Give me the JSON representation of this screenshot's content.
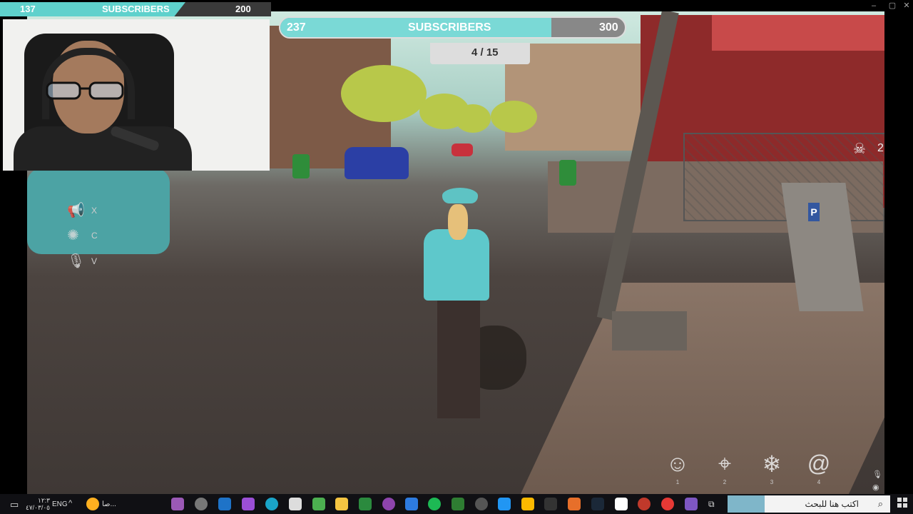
{
  "overlay": {
    "bar_small": {
      "current": "137",
      "label": "SUBSCRIBERS",
      "goal": "200"
    },
    "bar_large": {
      "current": "237",
      "label": "SUBSCRIBERS",
      "goal": "300"
    }
  },
  "game": {
    "skull_count": "2",
    "tracker_text": "4 / 15",
    "side_keys": [
      "X",
      "C",
      "V"
    ],
    "ability_slots": [
      "1",
      "2",
      "3",
      "4"
    ],
    "parking_sign": "P"
  },
  "taskbar": {
    "search_placeholder": "اكتب هنا للبحث",
    "language": "ENG",
    "time": "١٢:٣",
    "date": "٤٧/٠٣/٠٥",
    "pinned_label": "صا..."
  }
}
